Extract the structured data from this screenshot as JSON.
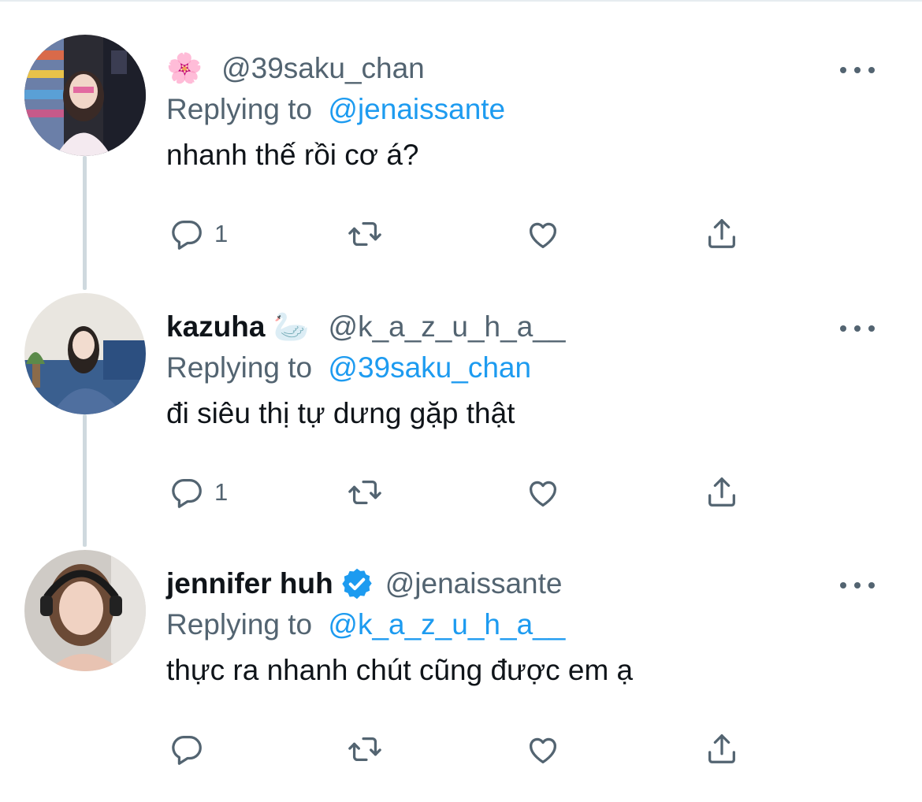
{
  "colors": {
    "accent": "#1d9bf0",
    "secondary_text": "#536471",
    "thread_line": "#cfd9de"
  },
  "tweets": [
    {
      "display_name": "",
      "name_emoji": "🌸",
      "handle": "@39saku_chan",
      "verified": false,
      "replying_prefix": "Replying to",
      "replying_to": "@jenaissante",
      "text": "nhanh thế rồi cơ á?",
      "reply_count": "1",
      "icons": [
        "reply-icon",
        "retweet-icon",
        "like-icon",
        "share-icon",
        "more-icon"
      ]
    },
    {
      "display_name": "kazuha",
      "name_emoji": "🦢",
      "handle": "@k_a_z_u_h_a__",
      "verified": false,
      "replying_prefix": "Replying to",
      "replying_to": "@39saku_chan",
      "text": "đi siêu thị tự dưng gặp thật",
      "reply_count": "1",
      "icons": [
        "reply-icon",
        "retweet-icon",
        "like-icon",
        "share-icon",
        "more-icon"
      ]
    },
    {
      "display_name": "jennifer huh",
      "name_emoji": "",
      "handle": "@jenaissante",
      "verified": true,
      "replying_prefix": "Replying to",
      "replying_to": "@k_a_z_u_h_a__",
      "text": "thực ra nhanh chút cũng được em ạ",
      "reply_count": "",
      "icons": [
        "reply-icon",
        "retweet-icon",
        "like-icon",
        "share-icon",
        "more-icon"
      ]
    }
  ]
}
